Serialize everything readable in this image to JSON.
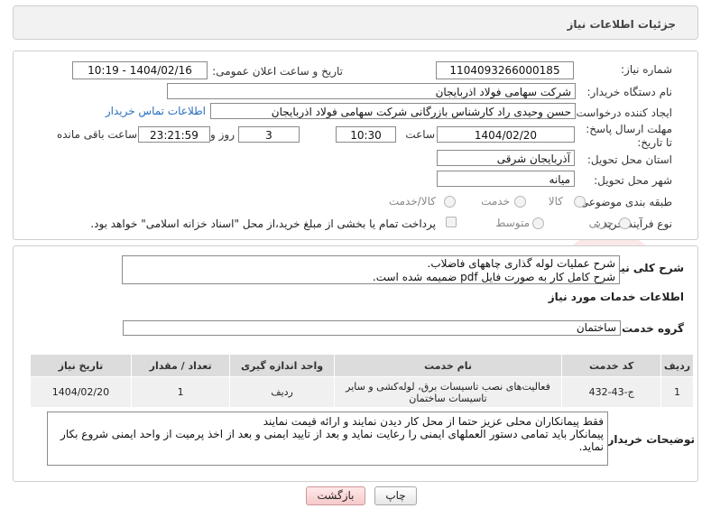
{
  "header": {
    "title": "جزئیات اطلاعات نیاز"
  },
  "fields": {
    "need_number_label": "شماره نیاز:",
    "need_number": "1104093266000185",
    "announce_label": "تاریخ و ساعت اعلان عمومی:",
    "announce_value": "1404/02/16 - 10:19",
    "buyer_org_label": "نام دستگاه خریدار:",
    "buyer_org": "شرکت سهامی فولاد اذربایجان",
    "creator_label": "ایجاد کننده درخواست:",
    "creator": "حسن وحیدی راد کارشناس بازرگانی شرکت سهامی فولاد اذربایجان",
    "contact_link": "اطلاعات تماس خریدار",
    "deadline_label": "مهلت ارسال پاسخ: تا تاریخ:",
    "deadline_date": "1404/02/20",
    "time_label": "ساعت",
    "deadline_time": "10:30",
    "days_value": "3",
    "days_label": "روز و",
    "remaining_value": "23:21:59",
    "remaining_label": "ساعت باقی مانده",
    "province_label": "استان محل تحویل:",
    "province": "آذربایجان شرقی",
    "city_label": "شهر محل تحویل:",
    "city": "میانه",
    "category_label": "طبقه بندی موضوعی:",
    "category_options": [
      "کالا",
      "خدمت",
      "کالا/خدمت"
    ],
    "process_label": "نوع فرآیند خرید :",
    "process_options": [
      "جزیی",
      "متوسط"
    ],
    "payment_note": "پرداخت تمام یا بخشی از مبلغ خرید،از محل \"اسناد خزانه اسلامی\" خواهد بود."
  },
  "description": {
    "label": "شرح کلی نیاز:",
    "line1": "شرح عملیات لوله گذاری چاههای فاضلاب.",
    "line2": "شرح کامل کار به صورت فایل pdf ضمیمه شده است."
  },
  "services": {
    "title": "اطلاعات خدمات مورد نیاز",
    "group_label": "گروه خدمت:",
    "group_value": "ساختمان",
    "columns": [
      "ردیف",
      "کد خدمت",
      "نام خدمت",
      "واحد اندازه گیری",
      "تعداد / مقدار",
      "تاریخ نیاز"
    ],
    "rows": [
      {
        "row": "1",
        "code": "ج-43-432",
        "name": "فعالیت‌های نصب تاسیسات برق، لوله‌کشی و سایر تاسیسات ساختمان",
        "unit": "ردیف",
        "qty": "1",
        "date": "1404/02/20"
      }
    ]
  },
  "buyer_notes": {
    "label": "توضیحات خریدار:",
    "line1": "فقط پیمانکاران محلی  عزیز حتما از محل کار دیدن نمایند و ارائه قیمت نمایند",
    "line2": "پیمانکار باید تمامی دستور العملهای ایمنی را رعایت نماید و بعد از تایید ایمنی  و بعد از اخذ پرمیت از واحد ایمنی شروع بکار",
    "line3": "نماید."
  },
  "buttons": {
    "print": "چاپ",
    "back": "بازگشت"
  },
  "colors": {
    "link": "#2a6fbd",
    "back_button": "#f7c9c9",
    "watermark": "#d44"
  }
}
